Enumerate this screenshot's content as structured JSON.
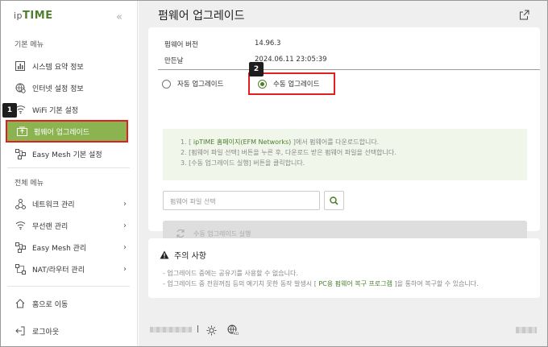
{
  "brand": {
    "logo_prefix": "ip",
    "logo_main": "TIME",
    "collapse_icon": "double-chevron-left-icon"
  },
  "sidebar": {
    "basic_section": "기본 메뉴",
    "basic_items": [
      {
        "label": "시스템 요약 정보",
        "icon": "bar-chart-icon"
      },
      {
        "label": "인터넷 설정 정보",
        "icon": "globe-settings-icon"
      },
      {
        "label": "WiFi 기본 설정",
        "icon": "wifi-icon"
      },
      {
        "label": "펌웨어 업그레이드",
        "icon": "firmware-upgrade-icon",
        "active": true
      },
      {
        "label": "Easy Mesh 기본 설정",
        "icon": "mesh-icon"
      }
    ],
    "all_section": "전체 메뉴",
    "all_items": [
      {
        "label": "네트워크 관리",
        "icon": "network-icon"
      },
      {
        "label": "무선랜 관리",
        "icon": "wifi-icon"
      },
      {
        "label": "Easy Mesh 관리",
        "icon": "mesh-icon"
      },
      {
        "label": "NAT/라우터 관리",
        "icon": "router-icon"
      }
    ],
    "home": "홈으로 이동",
    "logout": "로그아웃"
  },
  "callouts": {
    "first": "1",
    "second": "2"
  },
  "main": {
    "title": "펌웨어 업그레이드",
    "firmware_version_label": "펌웨어 버전",
    "firmware_version_value": "14.96.3",
    "build_date_label": "만든날",
    "build_date_value": "2024.06.11 23:05:39",
    "radio_auto": "자동 업그레이드",
    "radio_manual": "수동 업그레이드",
    "selected_mode": "manual",
    "info_lines": [
      {
        "prefix": "1. [ ",
        "highlight": "ipTIME 홈페이지(EFM Networks)",
        "suffix": " ]에서 펌웨어를 다운로드합니다."
      },
      {
        "prefix": "2. [펌웨어 파일 선택] 버튼을 누른 후, 다운로드 받은 펌웨어 파일을 선택합니다.",
        "highlight": "",
        "suffix": ""
      },
      {
        "prefix": "3. [수동 업그레이드 실행] 버튼을 클릭합니다.",
        "highlight": "",
        "suffix": ""
      }
    ],
    "file_placeholder": "펌웨어 파일 선택",
    "run_button": "수동 업그레이드 실행"
  },
  "caution": {
    "title": "주의 사항",
    "lines": [
      {
        "prefix": "- 업그레이드 중에는 공유기를 사용할 수 없습니다.",
        "highlight": "",
        "suffix": ""
      },
      {
        "prefix": "- 업그레이드 중 전원꺼짐 등의 예기치 못한 동작 발생시 [ ",
        "highlight": "PC용 펌웨어 복구 프로그램",
        "suffix": " ]을 통하여 복구할 수 있습니다."
      }
    ]
  },
  "footer": {
    "separator": "|",
    "theme_icon": "sun-icon",
    "language_icon": "globe-ko-icon"
  },
  "colors": {
    "accent": "#8bb34f",
    "brand_green": "#4d7f2c",
    "callout_red": "#e02020"
  }
}
